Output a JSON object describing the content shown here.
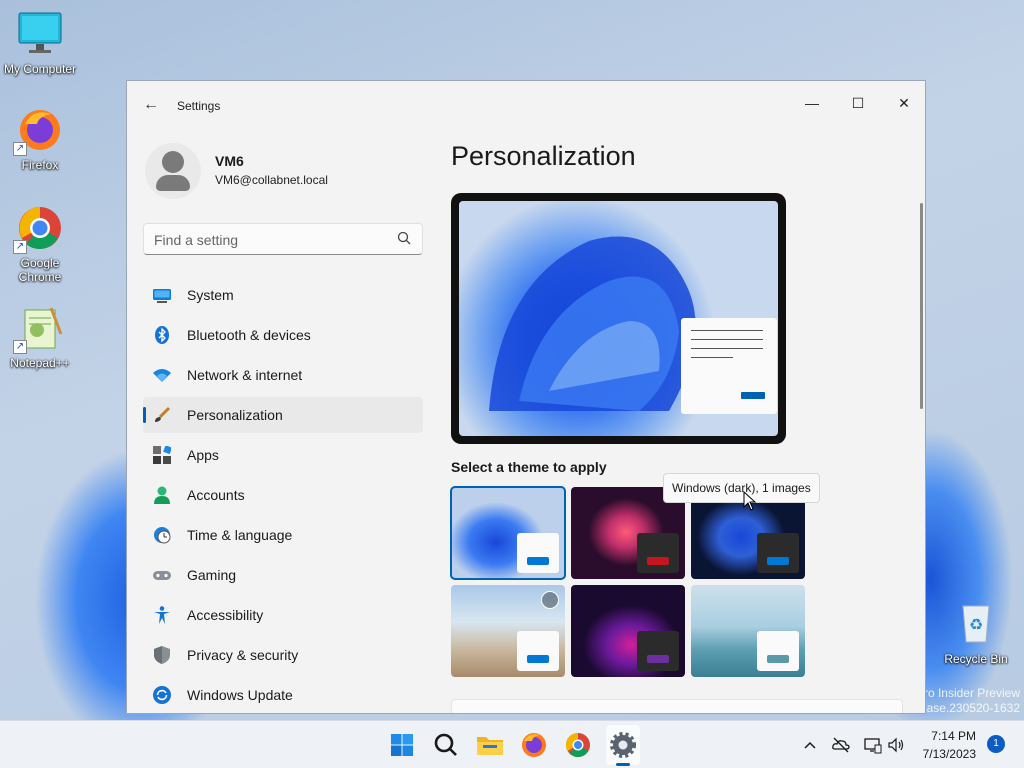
{
  "desktop": {
    "icons": [
      {
        "label": "My Computer"
      },
      {
        "label": "Firefox"
      },
      {
        "label": "Google Chrome"
      },
      {
        "label": "Notepad++"
      },
      {
        "label": "Recycle Bin"
      }
    ],
    "watermark_line1": "ro Insider Preview",
    "watermark_line2": "ease.230520-1632"
  },
  "window": {
    "app_title": "Settings",
    "back_icon": "back-arrow-icon",
    "controls": {
      "minimize": "—",
      "maximize": "☐",
      "close": "✕"
    }
  },
  "profile": {
    "name": "VM6",
    "email": "VM6@collabnet.local"
  },
  "search": {
    "placeholder": "Find a setting"
  },
  "nav": {
    "items": [
      {
        "label": "System",
        "icon": "monitor-icon"
      },
      {
        "label": "Bluetooth & devices",
        "icon": "bluetooth-icon"
      },
      {
        "label": "Network & internet",
        "icon": "wifi-icon"
      },
      {
        "label": "Personalization",
        "icon": "brush-icon",
        "active": true
      },
      {
        "label": "Apps",
        "icon": "apps-grid-icon"
      },
      {
        "label": "Accounts",
        "icon": "person-icon"
      },
      {
        "label": "Time & language",
        "icon": "globe-clock-icon"
      },
      {
        "label": "Gaming",
        "icon": "gamepad-icon"
      },
      {
        "label": "Accessibility",
        "icon": "accessibility-icon"
      },
      {
        "label": "Privacy & security",
        "icon": "shield-icon"
      },
      {
        "label": "Windows Update",
        "icon": "update-icon"
      }
    ]
  },
  "main": {
    "title": "Personalization",
    "themes_label": "Select a theme to apply",
    "tooltip": "Windows (dark), 1 images"
  },
  "colors": {
    "accent": "#005fb8",
    "selected_border": "#0063b1"
  },
  "taskbar": {
    "icons": [
      "start-icon",
      "search-icon",
      "file-explorer-icon",
      "firefox-icon",
      "chrome-icon",
      "settings-icon"
    ],
    "tray": [
      "show-hidden-icons-icon",
      "onedrive-icon",
      "network-icon",
      "volume-icon"
    ],
    "time": "7:14 PM",
    "date": "7/13/2023",
    "notification_count": "1"
  }
}
